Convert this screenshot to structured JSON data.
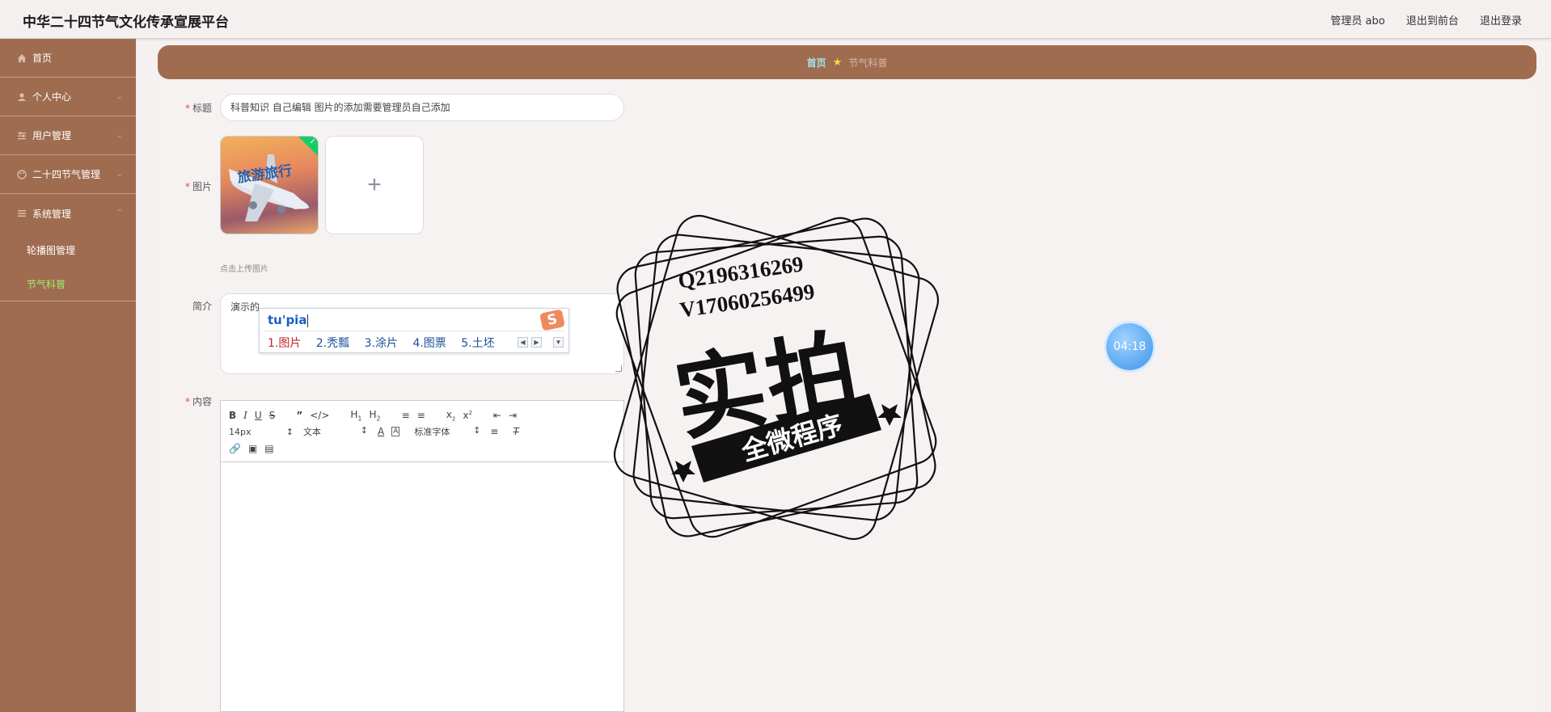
{
  "app": {
    "title": "中华二十四节气文化传承宣展平台"
  },
  "top_links": {
    "user": "管理员 abo",
    "front": "退出到前台",
    "logout": "退出登录"
  },
  "sidebar": {
    "items": [
      {
        "label": "首页",
        "icon": "home-icon"
      },
      {
        "label": "个人中心",
        "icon": "user-icon"
      },
      {
        "label": "用户管理",
        "icon": "sliders-icon"
      },
      {
        "label": "二十四节气管理",
        "icon": "palette-icon"
      },
      {
        "label": "系统管理",
        "icon": "list-icon"
      }
    ],
    "sub_items": [
      {
        "label": "轮播图管理"
      },
      {
        "label": "节气科普"
      }
    ]
  },
  "breadcrumb": {
    "home": "首页",
    "current": "节气科普"
  },
  "form": {
    "title_label": "标题",
    "title_value": "科普知识 自己编辑  图片的添加需要管理员自己添加",
    "image_label": "图片",
    "image_thumb_text": "旅游旅行",
    "upload_tip": "点击上传图片",
    "intro_label": "简介",
    "intro_value": "演示的",
    "content_label": "内容"
  },
  "ime": {
    "composition": "tu'pia",
    "candidates": [
      "1.图片",
      "2.秃瓢",
      "3.涂片",
      "4.图票",
      "5.土坯"
    ]
  },
  "editor": {
    "font_size": "14px",
    "block_format": "文本",
    "font_family": "标准字体"
  },
  "watermark": {
    "line1": "Q2196316269",
    "line2": "V17060256499",
    "big": "实拍",
    "ribbon": "全微程序"
  },
  "timer": {
    "value": "04:18"
  }
}
